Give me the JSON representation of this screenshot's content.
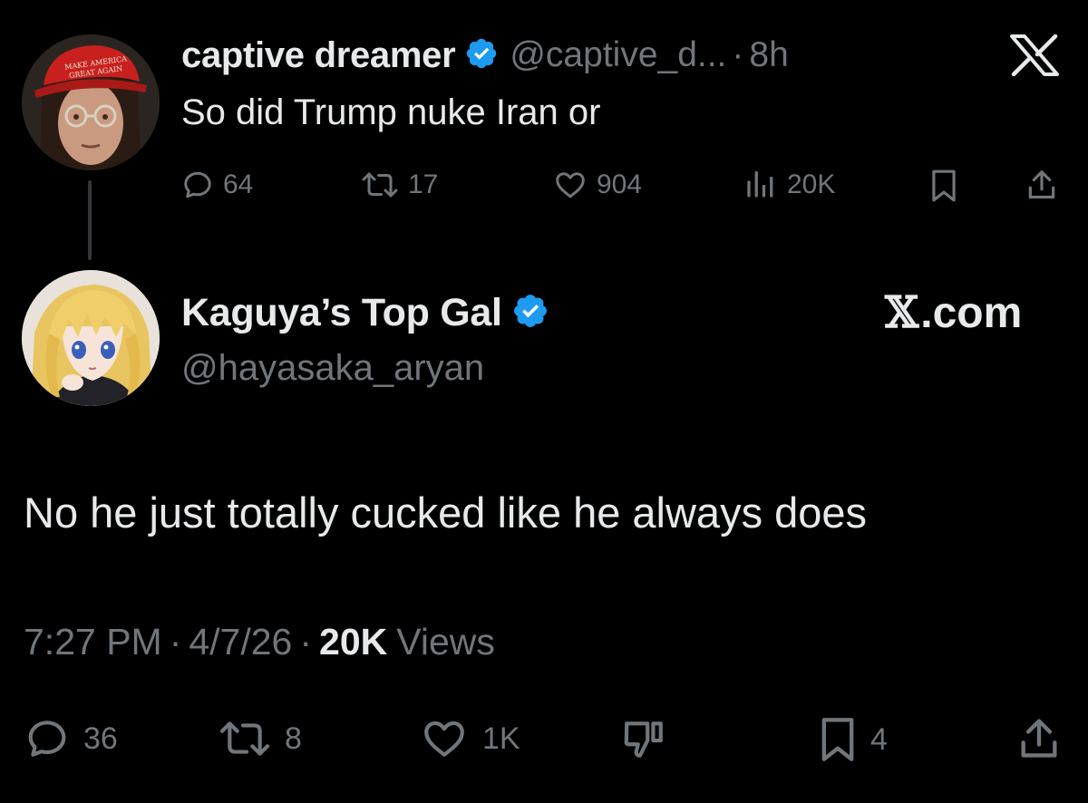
{
  "parent_tweet": {
    "display_name": "captive dreamer",
    "handle": "@captive_d...",
    "separator": "·",
    "time": "8h",
    "text": "So did Trump nuke Iran or",
    "avatar_hat_text": "MAKE AMERICA GREAT AGAIN",
    "actions": {
      "replies": "64",
      "reposts": "17",
      "likes": "904",
      "views": "20K"
    }
  },
  "reply_tweet": {
    "display_name": "Kaguya’s Top Gal",
    "handle": "@hayasaka_aryan",
    "text": "No he just totally cucked like he always does",
    "timestamp": "7:27 PM",
    "date": "4/7/26",
    "separator": "·",
    "views_count": "20K",
    "views_label": "Views",
    "actions": {
      "replies": "36",
      "reposts": "8",
      "likes": "1K",
      "bookmarks": "4"
    }
  },
  "brand": {
    "watermark_text": ".com",
    "watermark_glyph": "𝕏"
  },
  "colors": {
    "background": "#000000",
    "primary_text": "#e7e9ea",
    "secondary_text": "#71767b",
    "verified_blue": "#1d9bf0",
    "thread_line": "#333639"
  },
  "icons": {
    "verified": "verified-badge-icon",
    "reply": "reply-bubble-icon",
    "repost": "repost-icon",
    "like": "heart-icon",
    "views": "views-bar-chart-icon",
    "bookmark": "bookmark-icon",
    "share": "share-icon",
    "dislike": "thumbs-down-icon",
    "x_logo": "x-logo-icon"
  }
}
